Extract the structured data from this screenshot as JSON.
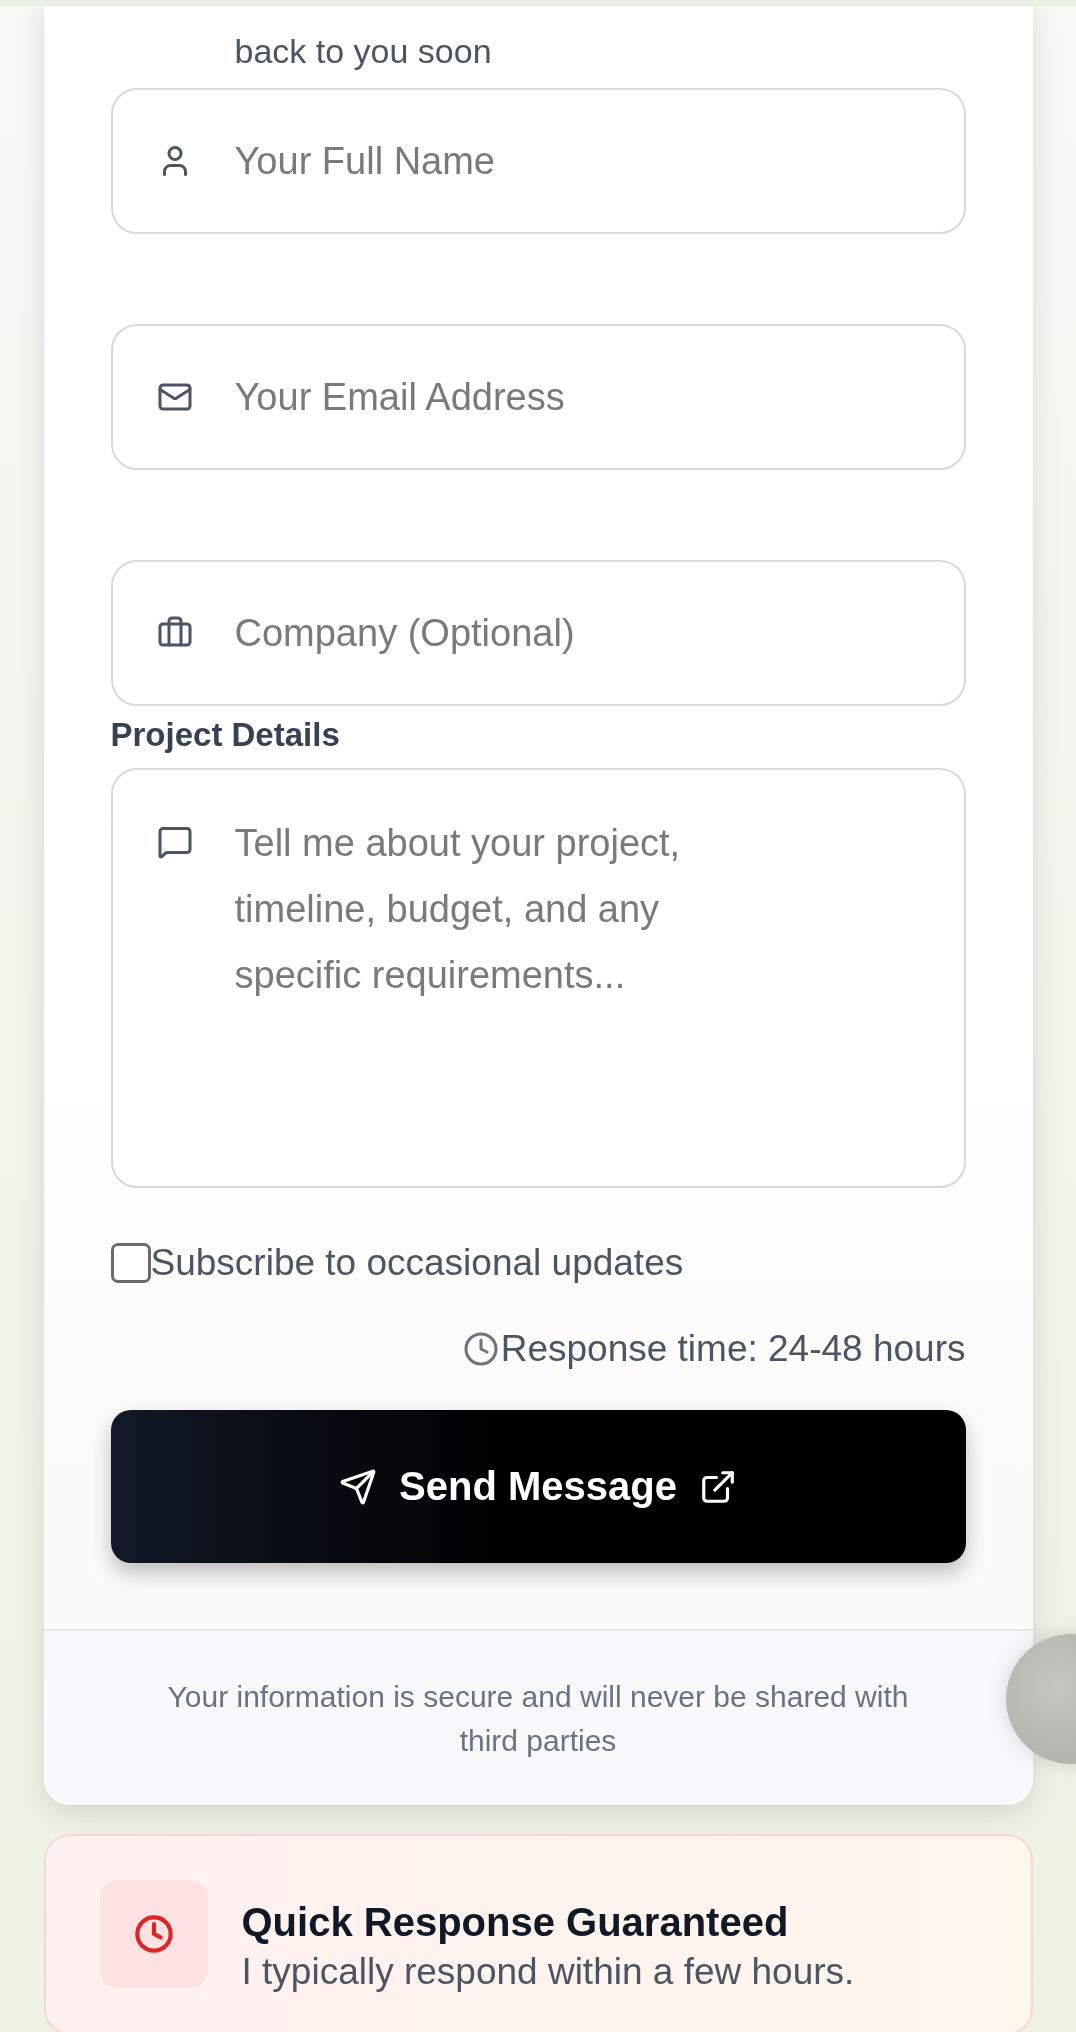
{
  "intro_text": "back to you soon",
  "fields": [
    {
      "kind": "name",
      "placeholder": "Your Full Name"
    },
    {
      "kind": "email",
      "placeholder": "Your Email Address"
    },
    {
      "kind": "company",
      "placeholder": "Company (Optional)"
    }
  ],
  "details": {
    "label": "Project Details",
    "placeholder": "Tell me about your project, timeline, budget, and any specific requirements..."
  },
  "subscribe": {
    "label": "Subscribe to occasional updates",
    "checked": false
  },
  "response_time": "Response time: 24-48 hours",
  "submit": {
    "label": "Send Message"
  },
  "privacy_note": "Your information is secure and will never be shared with third parties",
  "promo": {
    "title": "Quick Response Guaranteed",
    "text": "I typically respond within a few hours."
  }
}
